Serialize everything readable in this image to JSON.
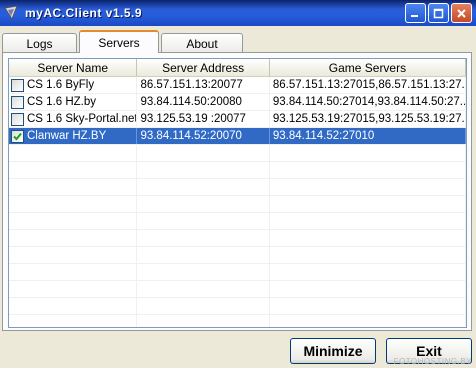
{
  "window": {
    "title": "myAC.Client  v1.5.9",
    "icon": "app-icon",
    "caption_buttons": [
      "minimize-icon",
      "maximize-icon",
      "close-icon"
    ]
  },
  "tabs": [
    {
      "label": "Logs",
      "active": false
    },
    {
      "label": "Servers",
      "active": true
    },
    {
      "label": "About",
      "active": false
    }
  ],
  "table": {
    "columns": [
      "Server Name",
      "Server Address",
      "Game Servers"
    ],
    "rows": [
      {
        "checked": false,
        "name": "CS 1.6 ByFly",
        "address": "86.57.151.13:20077",
        "game_servers": "86.57.151.13:27015,86.57.151.13:27..."
      },
      {
        "checked": false,
        "name": "CS 1.6 HZ.by",
        "address": "93.84.114.50:20080",
        "game_servers": "93.84.114.50:27014,93.84.114.50:27..."
      },
      {
        "checked": false,
        "name": "CS 1.6 Sky-Portal.net",
        "address": "93.125.53.19 :20077",
        "game_servers": "93.125.53.19:27015,93.125.53.19:27..."
      },
      {
        "checked": true,
        "name": "Clanwar HZ.BY",
        "address": "93.84.114.52:20070",
        "game_servers": "93.84.114.52:27010",
        "selected": true
      }
    ]
  },
  "buttons": {
    "minimize": "Minimize",
    "exit": "Exit"
  },
  "watermark": "FOTOHOSTING.BY",
  "colors": {
    "selection": "#316ac5",
    "titlebar": "#245edb",
    "tab_highlight": "#e68b2c"
  }
}
